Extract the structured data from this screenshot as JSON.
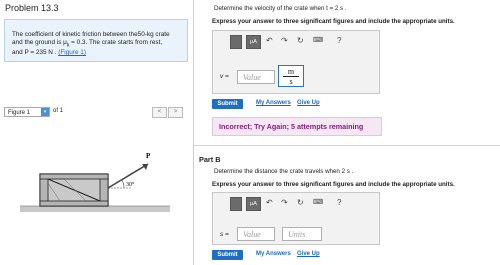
{
  "left": {
    "problem_title": "Problem 13.3",
    "problem_text_1": "The coefficient of kinetic friction between the50-kg crate",
    "problem_text_2": "and the ground is μ",
    "problem_text_2_sub": "k",
    "problem_text_2b": " = 0.3. The crate starts from rest,",
    "problem_text_3": "and P = 235 N .",
    "problem_link": "(Figure 1)",
    "figure_select": "Figure 1",
    "figure_of": "of 1",
    "nav_prev": "<",
    "nav_next": ">",
    "figure_force_label": "P",
    "figure_angle_label": "30°"
  },
  "partA": {
    "question": "Determine the velocity of the crate when t = 2 s .",
    "instruction": "Express your answer to three significant figures and include the appropriate units.",
    "toolbar_mu": "μA",
    "toolbar_help": "?",
    "var_label": "v =",
    "value_placeholder": "Value",
    "unit_numerator": "m",
    "unit_denominator": "s",
    "submit": "Submit",
    "my_answers": "My Answers",
    "give_up": "Give Up",
    "feedback": "Incorrect; Try Again; 5 attempts remaining"
  },
  "partB": {
    "title": "Part B",
    "question": "Determine the distance the crate travels when 2 s .",
    "instruction": "Express your answer to three significant figures and include the appropriate units.",
    "toolbar_mu": "μA",
    "toolbar_help": "?",
    "var_label": "s =",
    "value_placeholder": "Value",
    "units_placeholder": "Units",
    "submit": "Submit",
    "my_answers": "My Answers",
    "give_up": "Give Up"
  }
}
